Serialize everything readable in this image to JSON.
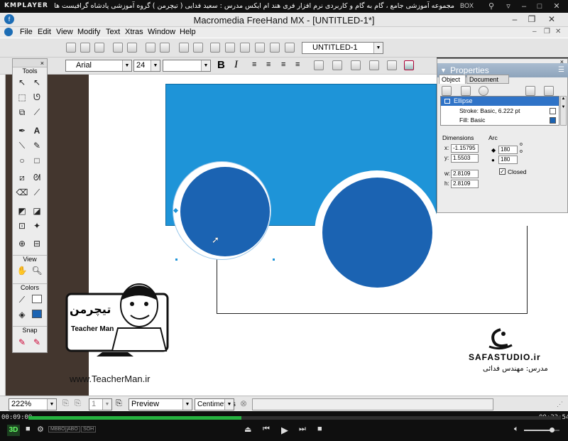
{
  "player": {
    "app_name": "KMPLAYER",
    "caption": "مجموعه آموزشی جامع ، گام به گام و کاربردی نرم افزار فری هند ام ایکس  مدرس : سعید فدایی ( تیچرمن ) گروه آموزشی پادشاه گرافیست ها",
    "box_label": "BOX",
    "time_elapsed": "00:09:09",
    "time_total": "00:22:54",
    "progress_fraction": 0.4,
    "volume_fraction": 0.78,
    "three_d_label": "3D",
    "mini_labels": [
      "MBBO",
      "ABO",
      "SOH"
    ]
  },
  "freehand": {
    "window_title": "Macromedia FreeHand MX - [UNTITLED-1*]",
    "menus": [
      "File",
      "Edit",
      "View",
      "Modify",
      "Text",
      "Xtras",
      "Window",
      "Help"
    ],
    "document_combo": "UNTITLED-1",
    "font_name": "Arial",
    "font_size": "24",
    "style_bold": "B",
    "style_italic": "I"
  },
  "tools_panel": {
    "title": "Tools",
    "view_label": "View",
    "colors_label": "Colors",
    "snap_label": "Snap"
  },
  "properties": {
    "title": "Properties",
    "tab_object": "Object",
    "tab_document": "Document",
    "list_items": [
      "Ellipse",
      "Stroke: Basic, 6.222 pt",
      "Fill: Basic"
    ],
    "dimensions_label": "Dimensions",
    "arc_label": "Arc",
    "x_label": "x:",
    "x_value": "-1.15795",
    "y_label": "y:",
    "y_value": "1.5503",
    "w_label": "w:",
    "w_value": "2.8109",
    "h_label": "h:",
    "h_value": "2.8109",
    "arc_start": "180",
    "arc_end": "180",
    "closed_label": "Closed",
    "closed_checked": true
  },
  "status_bar": {
    "zoom": "222%",
    "page": "1",
    "view_mode": "Preview",
    "units": "Centimeters"
  },
  "watermark": {
    "brand_left_fa": "تیچرمن",
    "brand_left_en": "Teacher Man",
    "site_left": "www.TeacherMan.ir",
    "brand_right": "SAFASTUDIO.ir",
    "instructor_right": "مدرس: مهندس فدائی"
  },
  "colors": {
    "canvas_blue": "#1e94d8",
    "ellipse_blue": "#1b63b2",
    "pasteboard_dark": "#43362e",
    "seek_green": "#26b240"
  }
}
